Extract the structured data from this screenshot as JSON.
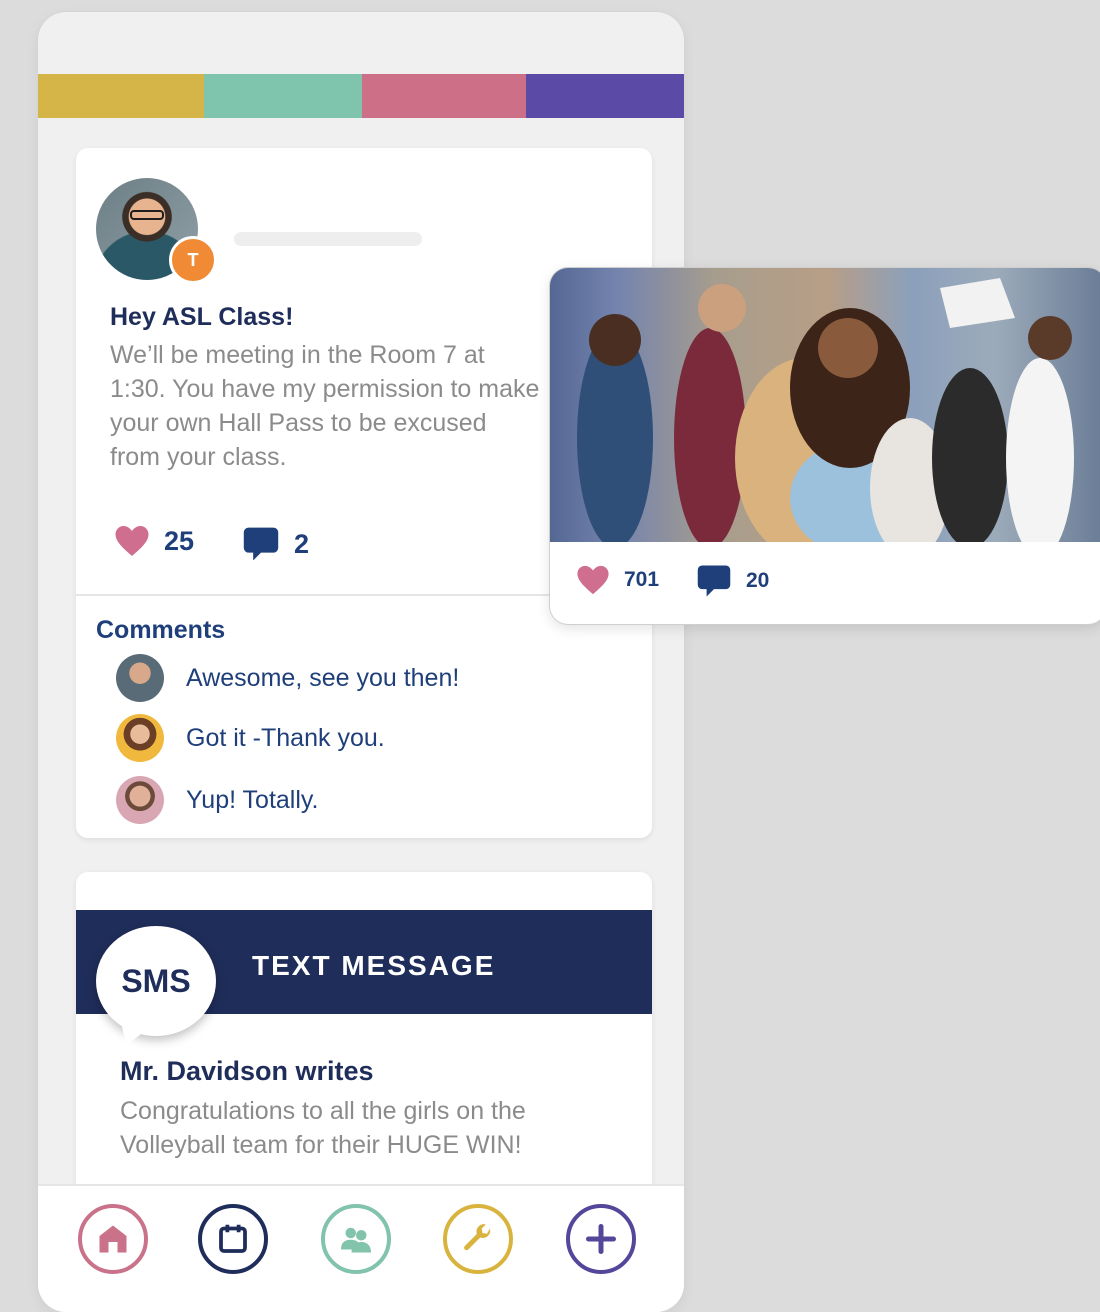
{
  "colors": {
    "bar": [
      "#d6b548",
      "#7fc4ac",
      "#cc6f87",
      "#5b4ba6"
    ],
    "navy": "#1f2d5a",
    "heart": "#cf6e8e",
    "badge": "#f08a35"
  },
  "post": {
    "author_badge": "T",
    "title": "Hey ASL Class!",
    "body": "We’ll be meeting in the Room 7 at 1:30. You have my permission to make your own Hall Pass to be excused from your class.",
    "likes": "25",
    "comments_count": "2",
    "comments_heading": "Comments",
    "comments": [
      {
        "text": "Awesome, see you then!"
      },
      {
        "text": "Got it -Thank you."
      },
      {
        "text": "Yup! Totally."
      }
    ]
  },
  "photo_post": {
    "likes": "701",
    "comments_count": "20"
  },
  "sms": {
    "badge": "SMS",
    "title": "TEXT MESSAGE",
    "author": "Mr. Davidson writes",
    "body": "Congratulations to all the girls on the Volleyball team for their HUGE WIN!"
  },
  "nav": {
    "icons": [
      "home-icon",
      "calendar-icon",
      "group-icon",
      "wrench-icon",
      "plus-icon"
    ]
  }
}
